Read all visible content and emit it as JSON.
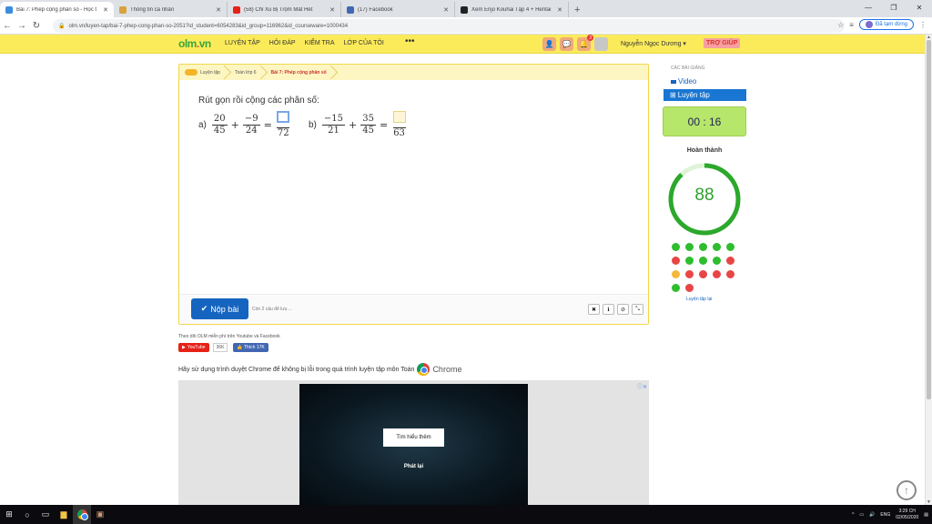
{
  "browser": {
    "tabs": [
      {
        "title": "Bài 7: Phép cộng phân số - Học t",
        "favicon_color": "#3b8ddd",
        "active": true
      },
      {
        "title": "Thông tin cá nhân",
        "favicon_color": "#d9a23b",
        "active": false
      },
      {
        "title": "(58) Chỉ Xu Bị Trộm Mất Hết",
        "favicon_color": "#e62117",
        "active": false
      },
      {
        "title": "(17) Facebook",
        "favicon_color": "#4267b2",
        "active": false
      },
      {
        "title": "Xem Enjo Kouhai Tập 4 + Hentai",
        "favicon_color": "#222222",
        "active": false
      }
    ],
    "new_tab": "+",
    "url": "olm.vn/luyen-tap/bai-7-phep-cong-phan-so-2051?id_student=6054283&id_group=116962&id_courseware=1000434",
    "sync_label": "Đã tạm dừng"
  },
  "header": {
    "logo_main": "olm",
    "logo_dot": ".",
    "logo_tld": "vn",
    "menu": [
      "LUYỆN TẬP",
      "HỎI ĐÁP",
      "KIỂM TRA",
      "LỚP CỦA TÔI"
    ],
    "more": "•••",
    "notification_count": "3",
    "user_name": "Nguyễn Ngọc Dương ▾",
    "help": "TRỢ GIÚP"
  },
  "breadcrumbs": [
    "Luyện tập",
    "Toán lớp 6",
    "Bài 7: Phép cộng phân số"
  ],
  "question": {
    "title": "Rút gọn rồi cộng các phân số:",
    "part_a": {
      "label": "a)",
      "f1_num": "20",
      "f1_den": "45",
      "op": "+",
      "f2_num": "−9",
      "f2_den": "24",
      "eq": "=",
      "ans_den": "72"
    },
    "part_b": {
      "label": "b)",
      "f1_num": "−15",
      "f1_den": "21",
      "op": "+",
      "f2_num": "35",
      "f2_den": "45",
      "eq": "=",
      "ans_den": "63"
    }
  },
  "footer": {
    "submit": "Nộp bài",
    "hint": "Còn 2 câu để lưu ..."
  },
  "social": {
    "follow": "Theo dõi OLM miễn phí trên Youtube và Facebook",
    "youtube": "YouTube",
    "yt_count": "36K",
    "facebook": "Thích 17K"
  },
  "chrome_note": {
    "text": "Hãy sử dụng trình duyệt Chrome để không bị lỗi trong quá trình luyện tập môn Toán",
    "brand": "Chrome"
  },
  "ad": {
    "learn_more": "Tìm hiểu thêm",
    "replay": "Phát lại"
  },
  "sidebar": {
    "lessons_heading": "CÁC BÀI GIẢNG",
    "video": "Video",
    "practice": "Luyện tập",
    "timer": "00 : 16",
    "done_label": "Hoàn thành",
    "score": "88",
    "progress": 0.88,
    "dots": [
      "g",
      "g",
      "g",
      "g",
      "g",
      "r",
      "g",
      "g",
      "g",
      "r",
      "y",
      "r",
      "r",
      "r",
      "r",
      "g",
      "r"
    ],
    "colors": {
      "g": "#2ebd2e",
      "r": "#e84545",
      "y": "#f4b93a"
    },
    "practice_link": "Luyện tập lại"
  },
  "taskbar": {
    "time": "3:29 CH",
    "date": "02/05/2020",
    "lang": "ENG"
  }
}
